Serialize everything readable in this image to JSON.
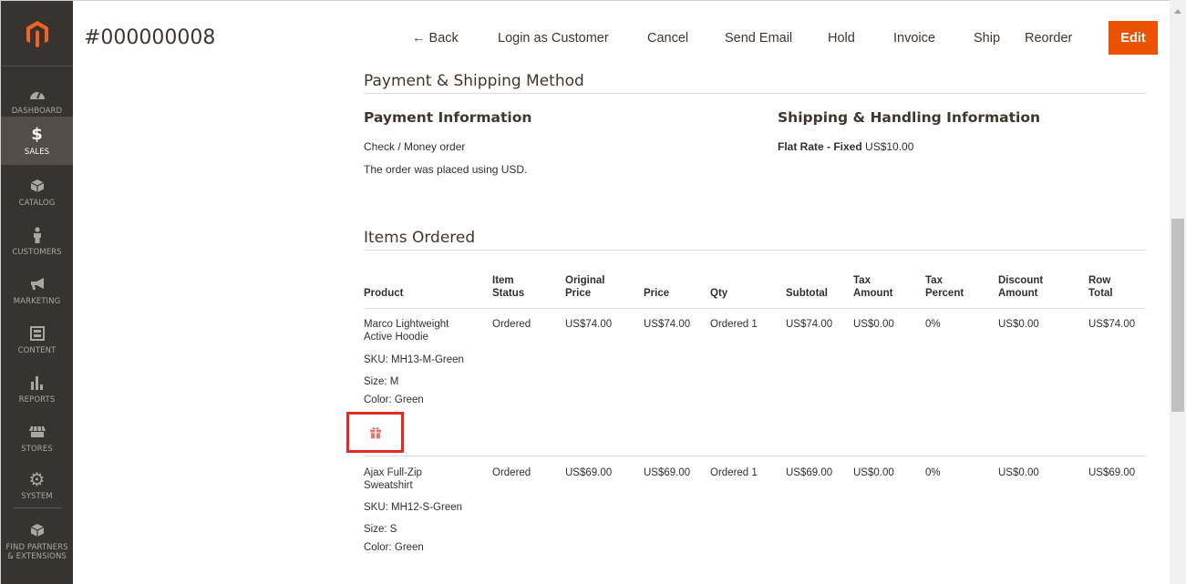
{
  "header": {
    "order_number": "#000000008",
    "actions": {
      "back": "← Back",
      "login_as_customer": "Login as Customer",
      "cancel": "Cancel",
      "send_email": "Send Email",
      "hold": "Hold",
      "invoice": "Invoice",
      "ship": "Ship",
      "reorder": "Reorder",
      "edit": "Edit"
    }
  },
  "sidebar": {
    "items": [
      {
        "label": "DASHBOARD",
        "icon": "dashboard-icon"
      },
      {
        "label": "SALES",
        "icon": "dollar-icon",
        "active": true
      },
      {
        "label": "CATALOG",
        "icon": "box-icon"
      },
      {
        "label": "CUSTOMERS",
        "icon": "person-icon"
      },
      {
        "label": "MARKETING",
        "icon": "megaphone-icon"
      },
      {
        "label": "CONTENT",
        "icon": "content-icon"
      },
      {
        "label": "REPORTS",
        "icon": "bar-chart-icon"
      },
      {
        "label": "STORES",
        "icon": "store-icon"
      },
      {
        "label": "SYSTEM",
        "icon": "gear-icon"
      },
      {
        "label": "FIND PARTNERS & EXTENSIONS",
        "label_line1": "FIND PARTNERS",
        "label_line2": "& EXTENSIONS",
        "icon": "cube-icon"
      }
    ]
  },
  "payment_shipping": {
    "section_title": "Payment & Shipping Method",
    "payment_title": "Payment Information",
    "payment_method": "Check / Money order",
    "payment_note": "The order was placed using USD.",
    "shipping_title": "Shipping & Handling Information",
    "shipping_method": "Flat Rate - Fixed",
    "shipping_price": "US$10.00"
  },
  "items_ordered": {
    "section_title": "Items Ordered",
    "columns": {
      "product": "Product",
      "item_status_1": "Item",
      "item_status_2": "Status",
      "original_price_1": "Original",
      "original_price_2": "Price",
      "price": "Price",
      "qty": "Qty",
      "subtotal": "Subtotal",
      "tax_amount_1": "Tax",
      "tax_amount_2": "Amount",
      "tax_percent_1": "Tax",
      "tax_percent_2": "Percent",
      "discount_amount_1": "Discount",
      "discount_amount_2": "Amount",
      "row_total_1": "Row",
      "row_total_2": "Total"
    },
    "rows": [
      {
        "name_1": "Marco Lightweight",
        "name_2": "Active Hoodie",
        "sku": "SKU: MH13-M-Green",
        "size": "Size: M",
        "color": "Color: Green",
        "status": "Ordered",
        "original_price": "US$74.00",
        "price": "US$74.00",
        "qty": "Ordered 1",
        "subtotal": "US$74.00",
        "tax_amount": "US$0.00",
        "tax_percent": "0%",
        "discount": "US$0.00",
        "row_total": "US$74.00"
      },
      {
        "name_1": "Ajax Full-Zip",
        "name_2": "Sweatshirt",
        "sku": "SKU: MH12-S-Green",
        "size": "Size: S",
        "color": "Color: Green",
        "status": "Ordered",
        "original_price": "US$69.00",
        "price": "US$69.00",
        "qty": "Ordered 1",
        "subtotal": "US$69.00",
        "tax_amount": "US$0.00",
        "tax_percent": "0%",
        "discount": "US$0.00",
        "row_total": "US$69.00"
      }
    ]
  },
  "colors": {
    "accent": "#eb5202",
    "sidebar_bg": "#373330",
    "gift_icon": "#e8746e",
    "highlight_box": "#e02b27"
  }
}
